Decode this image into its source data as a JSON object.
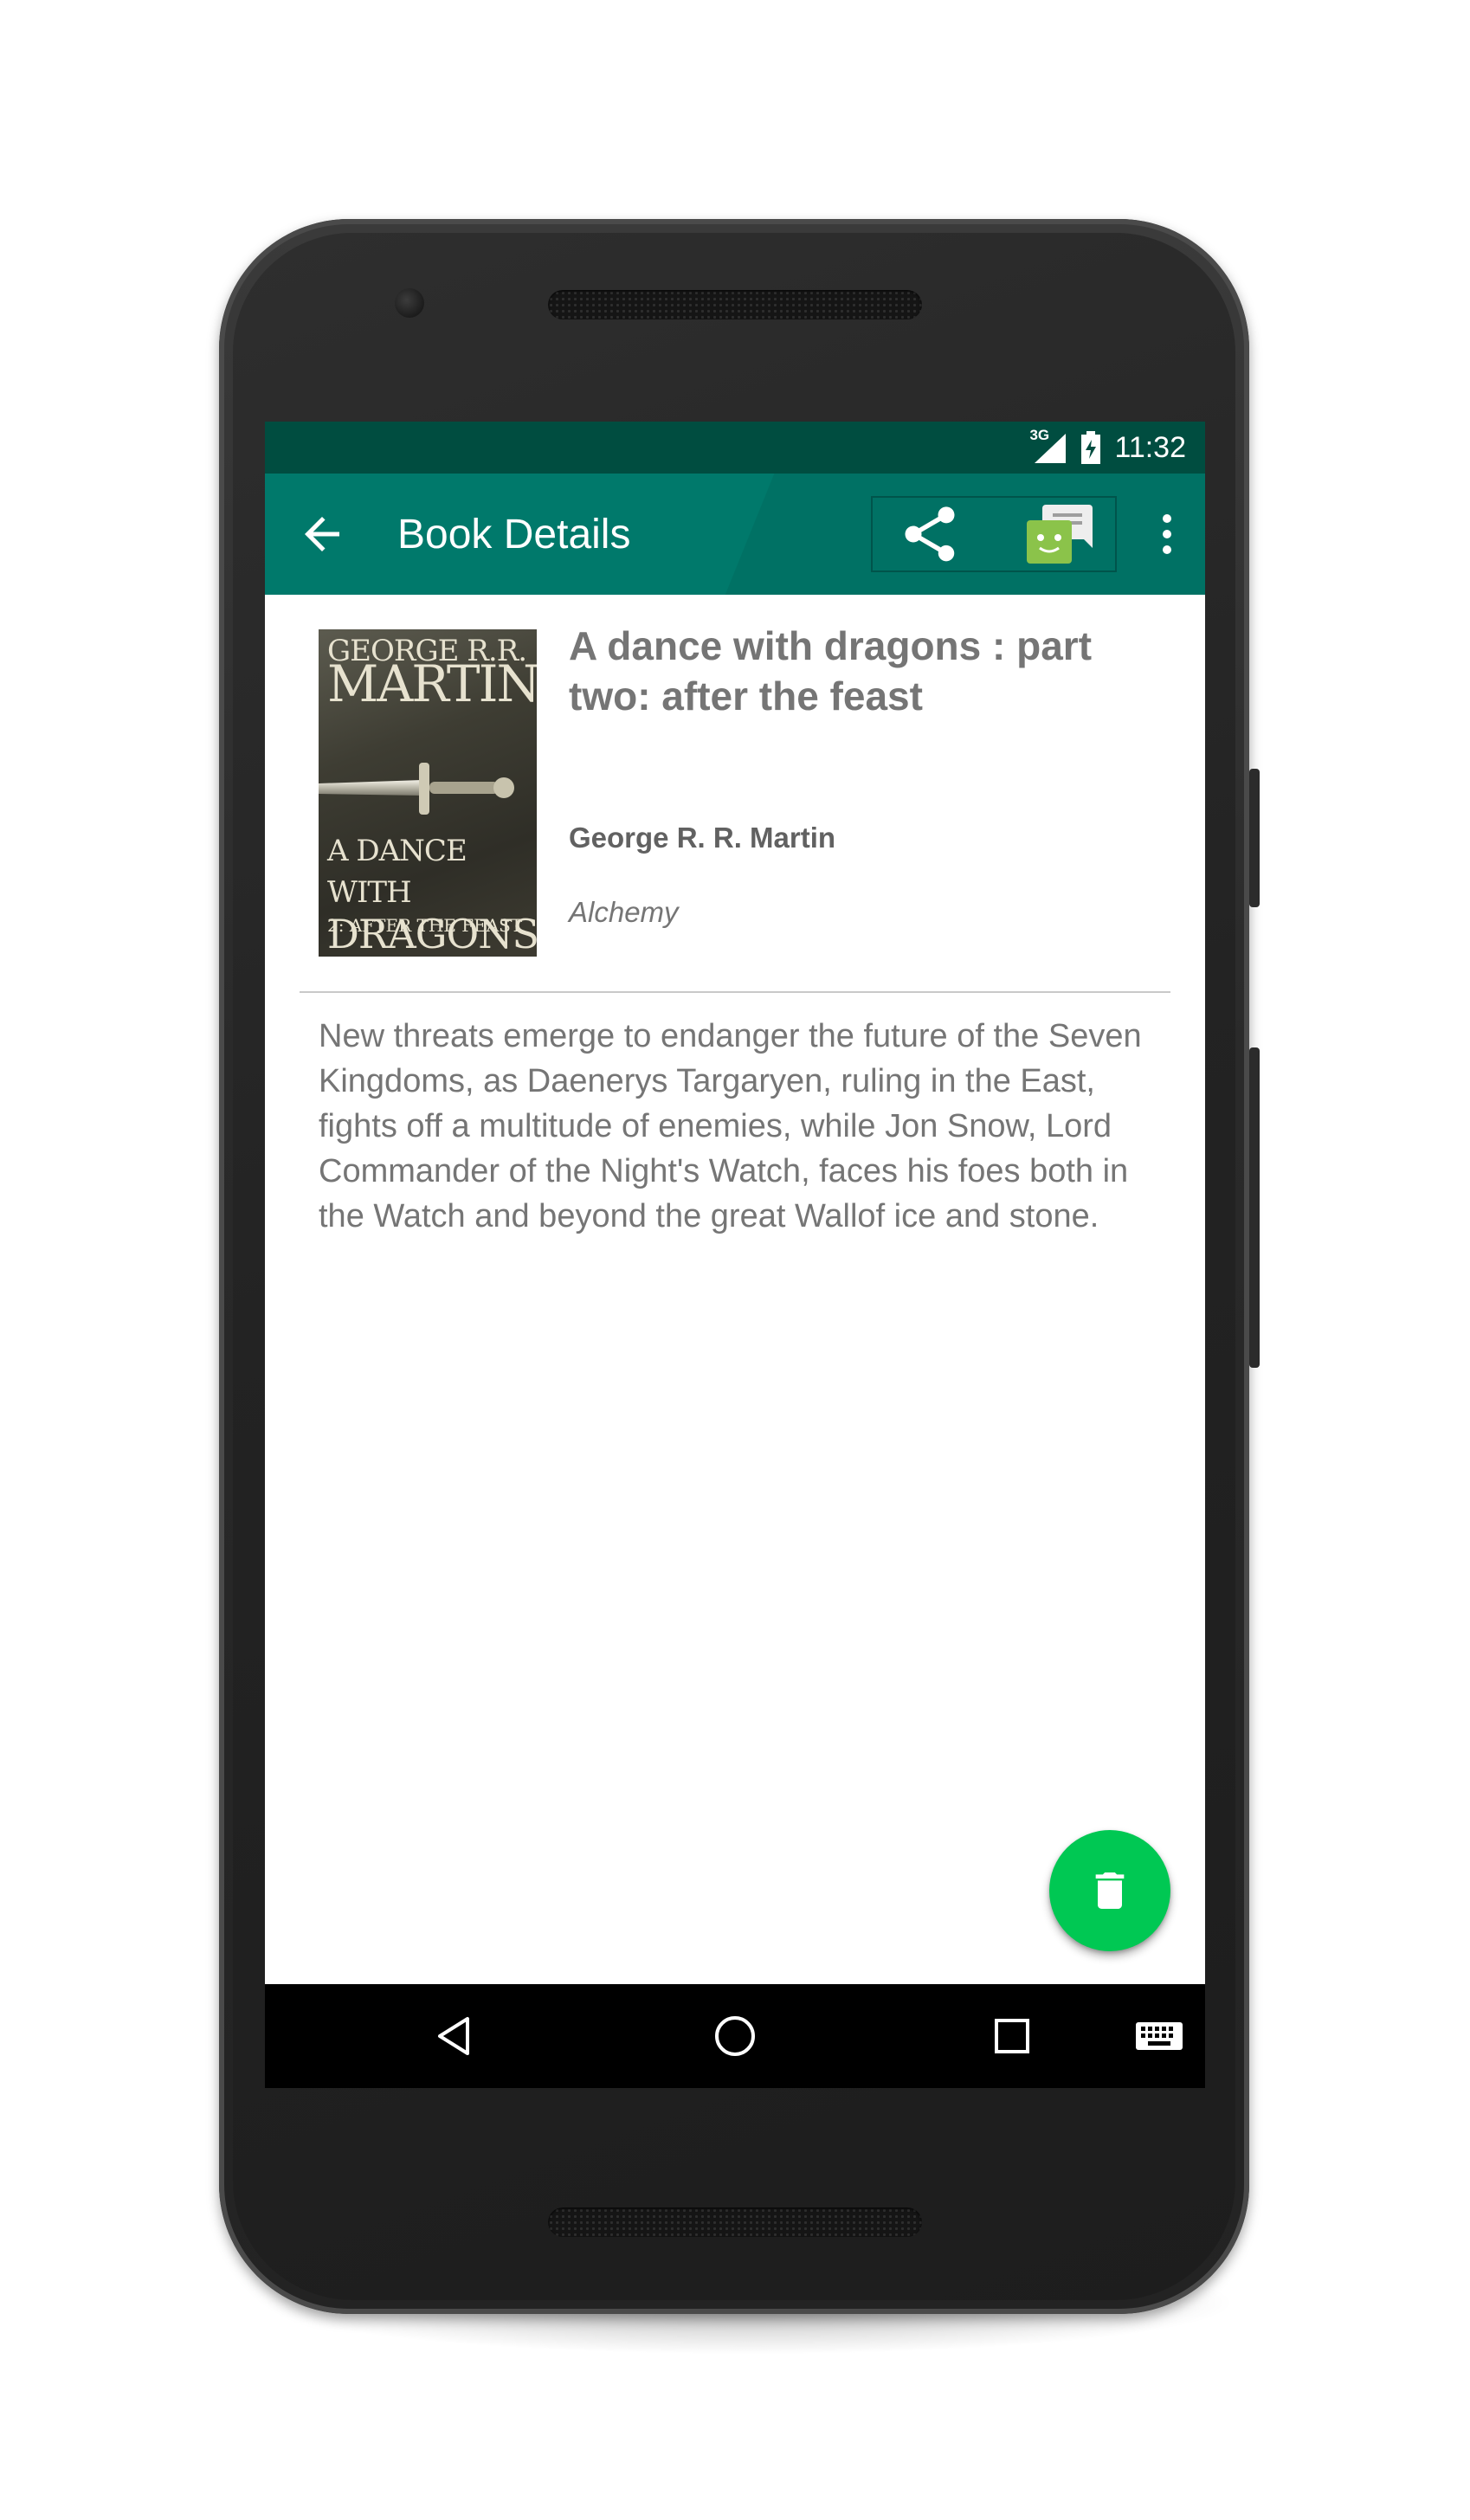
{
  "status_bar": {
    "network": "3G",
    "time": "11:32"
  },
  "app_bar": {
    "title": "Book Details",
    "back_icon": "arrow-back-icon",
    "share_icon": "share-icon",
    "chat_icon": "android-chat-icon",
    "overflow_icon": "more-vert-icon"
  },
  "book": {
    "cover": {
      "author_line1": "George R.R.",
      "author_line2": "Martin",
      "title_line1": "A Dance with",
      "title_line2": "Dragons",
      "subtitle": "2: After the Feast"
    },
    "title": "A dance with dragons : part two: after the feast",
    "author": "George R. R. Martin",
    "publisher": "Alchemy",
    "description": "New threats emerge to endanger the future of the Seven Kingdoms, as Daenerys Targaryen, ruling in the East, fights off a multitude of enemies, while Jon Snow, Lord Commander of the Night's Watch, faces his foes both in the Watch and beyond the great Wallof ice and stone."
  },
  "fab": {
    "icon": "delete-icon"
  },
  "nav_bar": {
    "back_icon": "nav-back-icon",
    "home_icon": "nav-home-icon",
    "recents_icon": "nav-recents-icon",
    "keyboard_icon": "keyboard-icon"
  },
  "colors": {
    "status_bar": "#004d40",
    "app_bar": "#00796b",
    "fab": "#00c853",
    "text_primary": "#757575"
  }
}
